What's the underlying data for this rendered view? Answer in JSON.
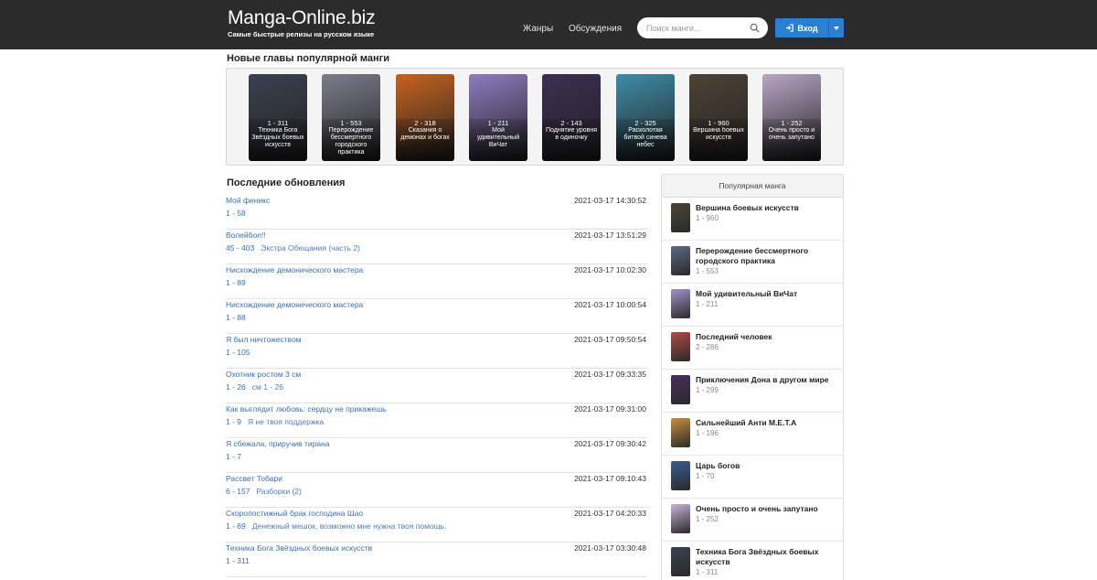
{
  "header": {
    "logo": "Manga-Online.biz",
    "tagline": "Самые быстрые релизы на русском языке",
    "nav": [
      "Жанры",
      "Обсуждения"
    ],
    "search_placeholder": "Поиск манги...",
    "login_label": "Вход"
  },
  "new_chapters": {
    "title": "Новые главы популярной манги",
    "items": [
      {
        "chapters": "1 - 311",
        "title": "Техника Бога Звёздных боевых искусств",
        "color": "#3a4250"
      },
      {
        "chapters": "1 - 553",
        "title": "Перерождение бессмертного городского практика",
        "color": "#7b7f8c"
      },
      {
        "chapters": "2 - 318",
        "title": "Сказания о демонах и богах",
        "color": "#c8631f"
      },
      {
        "chapters": "1 - 211",
        "title": "Мой удивительный ВиЧат",
        "color": "#8f7cc2"
      },
      {
        "chapters": "2 - 143",
        "title": "Поднятие уровня в одиночку",
        "color": "#3b2f52"
      },
      {
        "chapters": "2 - 325",
        "title": "Расколотая битвой синева небес",
        "color": "#3e8da8"
      },
      {
        "chapters": "1 - 960",
        "title": "Вершина боевых искусств",
        "color": "#4d4336"
      },
      {
        "chapters": "1 - 252",
        "title": "Очень просто и очень запутано",
        "color": "#b9a7c6"
      }
    ]
  },
  "updates": {
    "title": "Последние обновления",
    "items": [
      {
        "title": "Мой феникс",
        "date": "2021-03-17 14:30:52",
        "chapters": "1 - 58",
        "note": ""
      },
      {
        "title": "Волейбол!!",
        "date": "2021-03-17 13:51:29",
        "chapters": "45 - 403",
        "note": "Экстра Обещания (часть 2)"
      },
      {
        "title": "Нисхождение демонического мастера",
        "date": "2021-03-17 10:02:30",
        "chapters": "1 - 89",
        "note": ""
      },
      {
        "title": "Нисхождение демонического мастера",
        "date": "2021-03-17 10:00:54",
        "chapters": "1 - 88",
        "note": ""
      },
      {
        "title": "Я был ничтожеством",
        "date": "2021-03-17 09:50:54",
        "chapters": "1 - 105",
        "note": ""
      },
      {
        "title": "Охотник ростом 3 см",
        "date": "2021-03-17 09:33:35",
        "chapters": "1 - 26",
        "note": "см 1 - 26"
      },
      {
        "title": "Как выглядит любовь: сердцу не прикажешь",
        "date": "2021-03-17 09:31:00",
        "chapters": "1 - 9",
        "note": "Я не твоя поддержка"
      },
      {
        "title": "Я сбежала, приручив тирана",
        "date": "2021-03-17 09:30:42",
        "chapters": "1 - 7",
        "note": ""
      },
      {
        "title": "Рассвет Тобари",
        "date": "2021-03-17 09:10:43",
        "chapters": "6 - 157",
        "note": "Разборки (2)"
      },
      {
        "title": "Скоропостижный брак господина Шао",
        "date": "2021-03-17 04:20:33",
        "chapters": "1 - 69",
        "note": "Денежный мешок, возможно мне нужна твоя помощь."
      },
      {
        "title": "Техника Бога Звёздных боевых искусств",
        "date": "2021-03-17 03:30:48",
        "chapters": "1 - 311",
        "note": ""
      }
    ]
  },
  "popular": {
    "title": "Популярная манга",
    "items": [
      {
        "title": "Вершина боевых искусств",
        "chapters": "1 - 960",
        "color": "#4d4336"
      },
      {
        "title": "Перерождение бессмертного городского практика",
        "chapters": "1 - 553",
        "color": "#5a6a86"
      },
      {
        "title": "Мой удивительный ВиЧат",
        "chapters": "1 - 211",
        "color": "#a392c9"
      },
      {
        "title": "Последний человек",
        "chapters": "2 - 286",
        "color": "#b34a45"
      },
      {
        "title": "Приключения Дона в другом мире",
        "chapters": "1 - 299",
        "color": "#4a2e5c"
      },
      {
        "title": "Сильнейший Анти M.E.T.A",
        "chapters": "1 - 196",
        "color": "#c98f3c"
      },
      {
        "title": "Царь богов",
        "chapters": "1 - 70",
        "color": "#3c5c8f"
      },
      {
        "title": "Очень просто и очень запутано",
        "chapters": "1 - 252",
        "color": "#c7b3d4"
      },
      {
        "title": "Техника Бога Звёздных боевых искусств",
        "chapters": "1 - 311",
        "color": "#3a4250"
      }
    ]
  }
}
